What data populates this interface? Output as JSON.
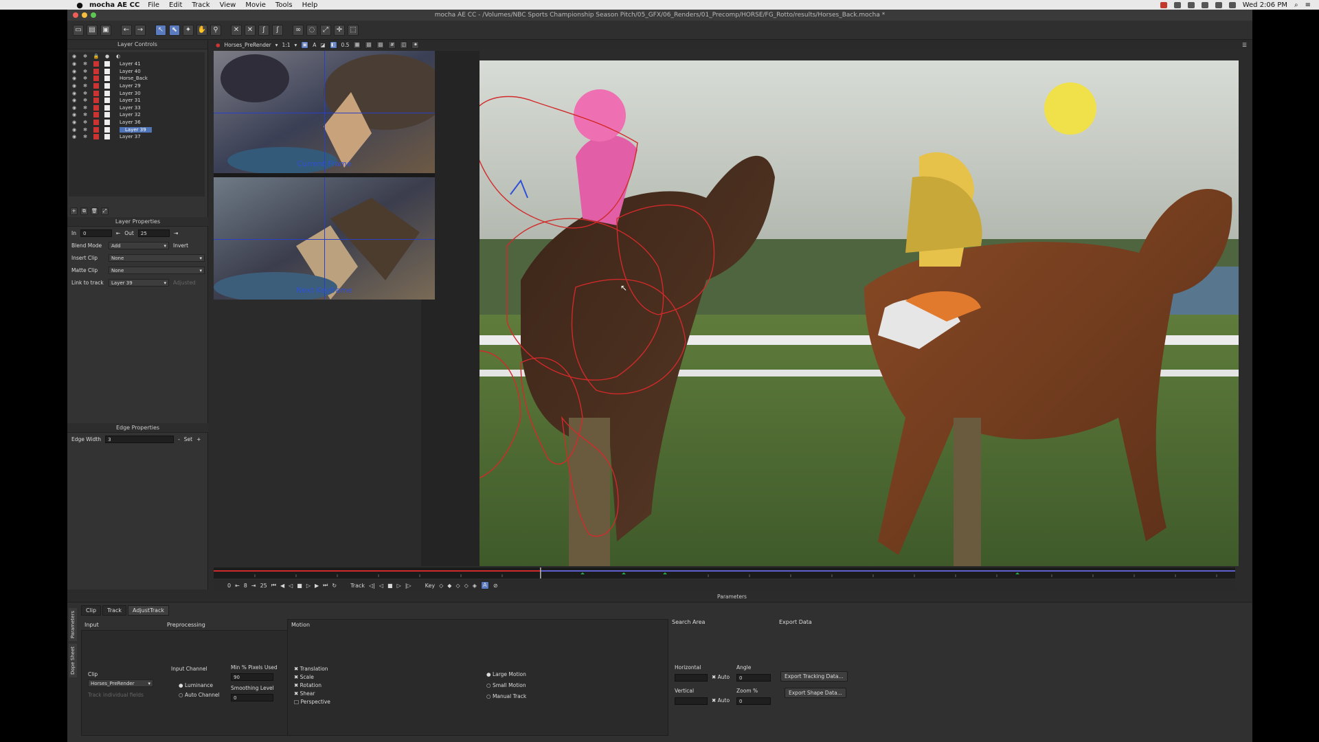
{
  "menubar": {
    "app_name": "mocha AE CC",
    "menus": [
      "File",
      "Edit",
      "Track",
      "View",
      "Movie",
      "Tools",
      "Help"
    ],
    "clock": "Wed 2:06 PM"
  },
  "window": {
    "title": "mocha AE CC - /Volumes/NBC Sports Championship Season Pitch/05_GFX/06_Renders/01_Precomp/HORSE/FG_Rotto/results/Horses_Back.mocha *"
  },
  "layer_controls": {
    "title": "Layer Controls",
    "layers": [
      {
        "name": "Layer 41",
        "selected": false
      },
      {
        "name": "Layer 40",
        "selected": false
      },
      {
        "name": "Horse_Back",
        "selected": false
      },
      {
        "name": "Layer 29",
        "selected": false
      },
      {
        "name": "Layer 30",
        "selected": false
      },
      {
        "name": "Layer 31",
        "selected": false
      },
      {
        "name": "Layer 33",
        "selected": false
      },
      {
        "name": "Layer 32",
        "selected": false
      },
      {
        "name": "Layer 36",
        "selected": false
      },
      {
        "name": "Layer 39",
        "selected": true
      },
      {
        "name": "Layer 37",
        "selected": false
      }
    ]
  },
  "layer_properties": {
    "title": "Layer Properties",
    "in_label": "In",
    "in_value": "0",
    "out_label": "Out",
    "out_value": "25",
    "blend_mode_label": "Blend Mode",
    "blend_mode_value": "Add",
    "invert_label": "Invert",
    "insert_clip_label": "Insert Clip",
    "insert_clip_value": "None",
    "matte_clip_label": "Matte Clip",
    "matte_clip_value": "None",
    "link_to_track_label": "Link to track",
    "link_to_track_value": "Layer 39",
    "adjusted_label": "Adjusted"
  },
  "edge_properties": {
    "title": "Edge Properties",
    "edge_width_label": "Edge Width",
    "edge_width_value": "3",
    "set_label": "Set"
  },
  "viewer": {
    "clip_name": "Horses_PreRender",
    "zoom": "1:1",
    "opacity": "0.5",
    "current_frame_label": "Current Frame",
    "next_keyframe_label": "Next Keyframe"
  },
  "transport": {
    "in_frame": "0",
    "current_frame": "8",
    "out_frame": "25",
    "track_label": "Track",
    "key_label": "Key",
    "playhead_fraction": 0.32
  },
  "parameters": {
    "title": "Parameters",
    "tabs": [
      "Clip",
      "Track",
      "AdjustTrack"
    ],
    "active_tab": "Track",
    "side_tabs": [
      "Parameters",
      "Dope Sheet"
    ],
    "input_label": "Input",
    "clip_label": "Clip",
    "clip_value": "Horses_PreRender",
    "track_individual_fields": "Track individual fields",
    "preprocessing_label": "Preprocessing",
    "input_channel_label": "Input Channel",
    "luminance": "Luminance",
    "auto_channel": "Auto Channel",
    "min_pixels_label": "Min % Pixels Used",
    "min_pixels_value": "90",
    "smoothing_label": "Smoothing Level",
    "smoothing_value": "0",
    "motion_label": "Motion",
    "motion_options": [
      "Translation",
      "Scale",
      "Rotation",
      "Shear",
      "Perspective"
    ],
    "motion_checked": [
      true,
      true,
      true,
      true,
      false
    ],
    "motion_size_options": [
      "Large Motion",
      "Small Motion",
      "Manual Track"
    ],
    "search_area_label": "Search Area",
    "horizontal_label": "Horizontal",
    "vertical_label": "Vertical",
    "auto_label": "Auto",
    "angle_label": "Angle",
    "angle_value": "0",
    "zoom_label": "Zoom %",
    "zoom_value": "0",
    "export_data_label": "Export Data",
    "export_tracking": "Export Tracking Data...",
    "export_shape": "Export Shape Data..."
  },
  "colors": {
    "accent": "#4f74b8",
    "spline": "#d12a2a",
    "crosshair": "#2a3fc8"
  }
}
